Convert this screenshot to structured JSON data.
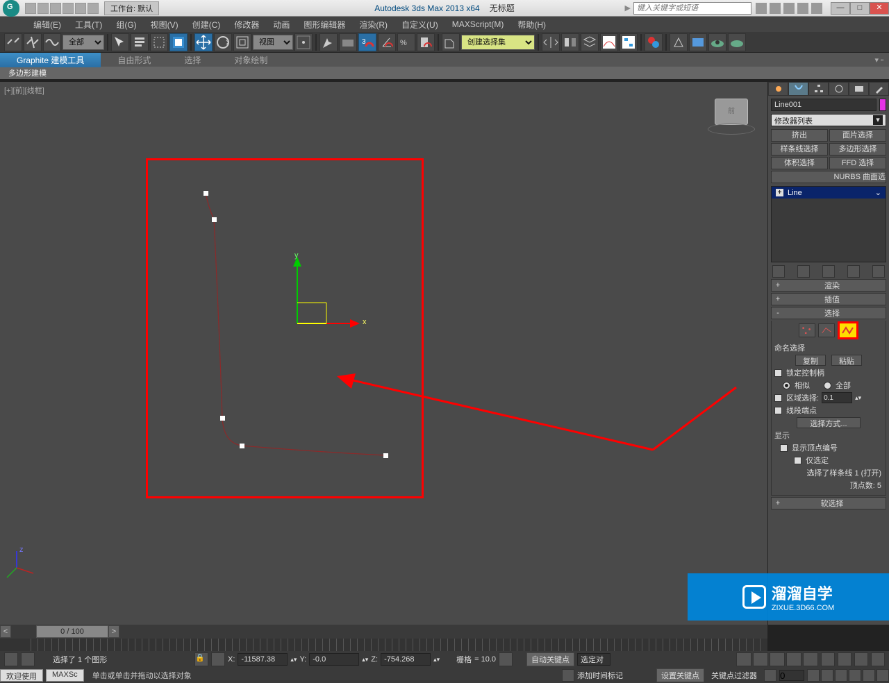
{
  "title": {
    "app": "Autodesk 3ds Max  2013 x64",
    "doc": "无标题"
  },
  "workspace": "工作台: 默认",
  "search_placeholder": "键入关键字或短语",
  "menu": [
    "编辑(E)",
    "工具(T)",
    "组(G)",
    "视图(V)",
    "创建(C)",
    "修改器",
    "动画",
    "图形编辑器",
    "渲染(R)",
    "自定义(U)",
    "MAXScript(M)",
    "帮助(H)"
  ],
  "toolbar": {
    "sel_filter": "全部",
    "ref_sys": "视图",
    "named_sel": "创建选择集"
  },
  "ribbon_tabs": [
    "Graphite 建模工具",
    "自由形式",
    "选择",
    "对象绘制"
  ],
  "ribbon_sub": "多边形建模",
  "viewport": {
    "label": "[+][前][线框]",
    "cube": "前"
  },
  "axis": {
    "x": "x",
    "y": "y",
    "z": "z"
  },
  "modify": {
    "obj_name": "Line001",
    "modlist_label": "修改器列表",
    "btn_extrude": "挤出",
    "btn_face_sel": "面片选择",
    "btn_spline_sel": "样条线选择",
    "btn_poly_sel": "多边形选择",
    "btn_vol_sel": "体积选择",
    "btn_ffd_sel": "FFD 选择",
    "btn_nurbs": "NURBS 曲面选",
    "stack_item": "Line",
    "roll_render": "渲染",
    "roll_interp": "插值",
    "roll_select": "选择",
    "named_label": "命名选择",
    "copy": "复制",
    "paste": "粘贴",
    "lock_handles": "锁定控制柄",
    "alike": "相似",
    "all": "全部",
    "area_sel": "区域选择:",
    "area_val": "0.1",
    "seg_end": "线段端点",
    "sel_by": "选择方式...",
    "display": "显示",
    "show_vtx_num": "显示顶点编号",
    "sel_only": "仅选定",
    "sel_info1": "选择了样条线 1 (打开)",
    "sel_info2": "顶点数: 5",
    "roll_soft": "软选择"
  },
  "time": {
    "slider": "0 / 100"
  },
  "coords": {
    "sel_prompt": "选择了 1 个图形",
    "x_lbl": "X:",
    "x": "-11587.38",
    "y_lbl": "Y:",
    "y": "-0.0",
    "z_lbl": "Z:",
    "z": "-754.268",
    "grid_lbl": "栅格",
    "grid": "= 10.0",
    "autokey": "自动关键点",
    "setkey": "设置关键点",
    "selset": "选定对",
    "keyfilters": "关键点过滤器"
  },
  "status": {
    "welcome": "欢迎使用",
    "box2": "MAXSc",
    "prompt": "单击或单击并拖动以选择对象",
    "add_time_tag": "添加时间标记"
  },
  "watermark": {
    "brand": "溜溜自学",
    "url": "ZIXUE.3D66.COM"
  },
  "icons": {
    "new": "new-icon",
    "open": "open-icon",
    "save": "save-icon",
    "undo": "undo-icon",
    "redo": "redo-icon",
    "link-icon": "link",
    "unlink-icon": "unlink",
    "bind-icon": "bind",
    "select-icon": "select",
    "paint-sel-icon": "paint-sel",
    "rect-sel-icon": "rect",
    "window-cross-icon": "wincross",
    "move-icon": "move",
    "rotate-icon": "rotate",
    "scale-icon": "scale",
    "snap-icon": "snap",
    "angle-snap-icon": "angle",
    "percent-snap-icon": "percent",
    "spinner-snap-icon": "spinsnap",
    "mirror-icon": "mirror",
    "align-icon": "align",
    "layers-icon": "layers",
    "curve-editor-icon": "curve",
    "schematic-icon": "schem",
    "mat-editor-icon": "mat",
    "render-setup-icon": "rsetup",
    "render-frame-icon": "rframe",
    "render-icon": "render"
  },
  "panel_tabs": [
    "create",
    "modify",
    "hierarchy",
    "motion",
    "display",
    "utilities"
  ]
}
